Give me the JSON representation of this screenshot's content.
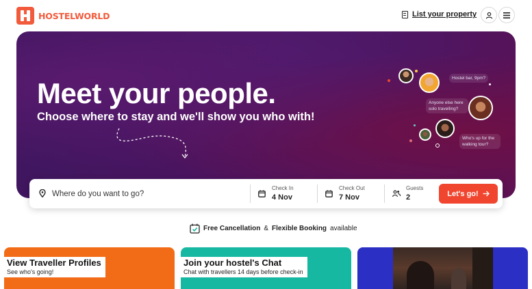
{
  "header": {
    "logo_text": "HOSTELWORLD",
    "list_property": "List your property",
    "icons": {
      "user": "user-icon",
      "menu": "hamburger-menu-icon"
    }
  },
  "hero": {
    "title": "Meet your people.",
    "subtitle": "Choose where to stay and we'll show you who with!",
    "bubbles": {
      "b1": "Hostel bar, 9pm?",
      "b2": "Anyone else here solo travelling?",
      "b3": "Who's up for the walking tour?"
    }
  },
  "search": {
    "placeholder": "Where do you want to go?",
    "check_in_label": "Check In",
    "check_in_value": "4 Nov",
    "check_out_label": "Check Out",
    "check_out_value": "7 Nov",
    "guests_label": "Guests",
    "guests_value": "2",
    "submit_label": "Let's go!"
  },
  "cancellation": {
    "part1": "Free Cancellation",
    "amp": "&",
    "part2": "Flexible Booking",
    "part3": "available"
  },
  "cards": [
    {
      "title": "View Traveller Profiles",
      "subtitle": "See who's going!"
    },
    {
      "title": "Join your hostel's Chat",
      "subtitle": "Chat with travellers 14 days before check-in"
    }
  ],
  "colors": {
    "brand": "#f25a3c",
    "cta": "#f0462f",
    "hero_bg": "#4a1460",
    "card_orange": "#f26b16",
    "card_teal": "#17b8a1",
    "card_blue": "#2b2fc4"
  }
}
